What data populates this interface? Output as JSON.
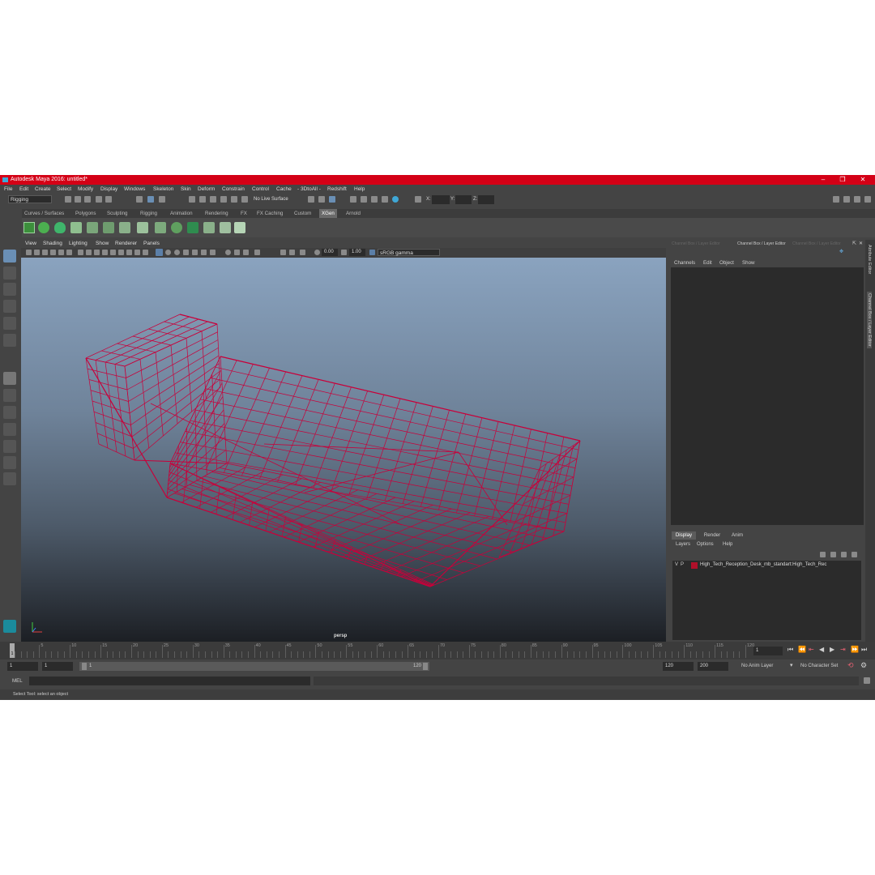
{
  "window": {
    "title": "Autodesk Maya 2016: untitled*"
  },
  "menubar": [
    "File",
    "Edit",
    "Create",
    "Select",
    "Modify",
    "Display",
    "Windows",
    "Skeleton",
    "Skin",
    "Deform",
    "Constrain",
    "Control",
    "Cache",
    "- 3DtoAll -",
    "Redshift",
    "Help"
  ],
  "statusline": {
    "mode_menu": "Rigging",
    "live_surface": "No Live Surface",
    "x_label": "X:",
    "y_label": "Y:",
    "z_label": "Z:"
  },
  "shelf_tabs": [
    "Curves / Surfaces",
    "Polygons",
    "Sculpting",
    "Rigging",
    "Animation",
    "Rendering",
    "FX",
    "FX Caching",
    "Custom",
    "XGen",
    "Arnold"
  ],
  "active_shelf_tab": "XGen",
  "panel_menu": [
    "View",
    "Shading",
    "Lighting",
    "Show",
    "Renderer",
    "Panels"
  ],
  "panel_toolbar": {
    "exposure": "0.00",
    "gamma": "1.00",
    "color_space": "sRGB gamma"
  },
  "viewport": {
    "camera": "persp",
    "wire_color": "#c8003a"
  },
  "channel_box": {
    "header_left": "Channel Box / Layer Editor",
    "header_center": "Channel Box / Layer Editor",
    "header_right": "Channel Box / Layer Editor",
    "menus": [
      "Channels",
      "Edit",
      "Object",
      "Show"
    ],
    "layer_tabs": [
      "Display",
      "Render",
      "Anim"
    ],
    "active_layer_tab": "Display",
    "layer_menus": [
      "Layers",
      "Options",
      "Help"
    ],
    "layer": {
      "v": "V",
      "p": "P",
      "color": "#b0102a",
      "name": "High_Tech_Reception_Desk_mb_standart:High_Tech_Rec"
    }
  },
  "right_strip": {
    "attr_editor": "Attribute Editor",
    "channel_box": "Channel Box / Layer Editor"
  },
  "timeline": {
    "ticks": [
      "5",
      "10",
      "15",
      "20",
      "25",
      "30",
      "35",
      "40",
      "45",
      "50",
      "55",
      "60",
      "65",
      "70",
      "75",
      "80",
      "85",
      "90",
      "95",
      "100",
      "105",
      "110",
      "115",
      "120"
    ],
    "current_frame": "1",
    "frame_marker": "1"
  },
  "range": {
    "start": "1",
    "start2": "1",
    "slider_start": "1",
    "slider_end": "120",
    "end": "120",
    "end2": "200",
    "anim_layer": "No Anim Layer",
    "char_set": "No Character Set"
  },
  "cmdline": {
    "label": "MEL"
  },
  "helpline": {
    "text": "Select Tool: select an object"
  }
}
